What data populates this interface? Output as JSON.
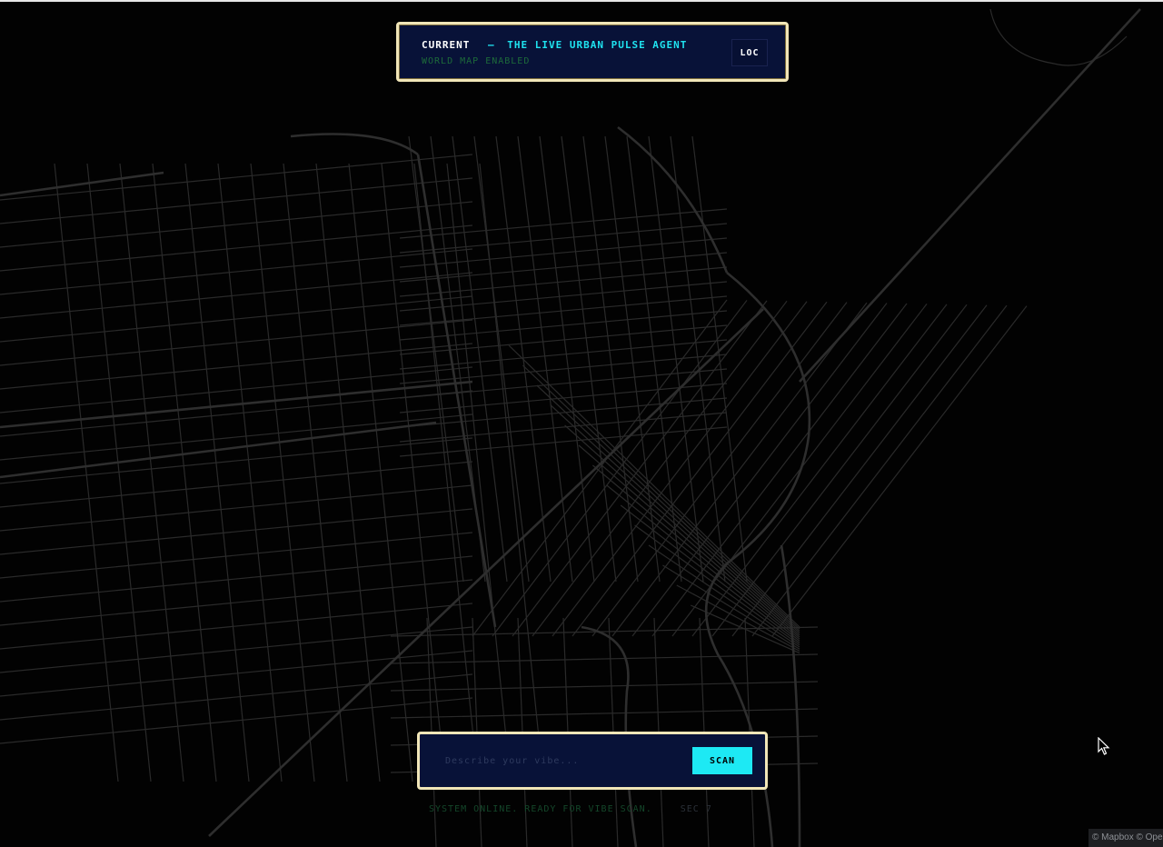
{
  "header": {
    "current_label": "CURRENT",
    "separator": "–",
    "app_name": "THE LIVE URBAN PULSE AGENT",
    "subtitle": "WORLD MAP ENABLED",
    "loc_button_label": "LOC"
  },
  "search": {
    "placeholder": "Describe your vibe...",
    "value": "",
    "scan_button_label": "SCAN"
  },
  "status": {
    "message": "SYSTEM ONLINE. READY FOR VIBE SCAN.",
    "sector": "SEC 7"
  },
  "map": {
    "attribution": "© Mapbox © OpenStreetMap",
    "road_color": "#2a2a2a",
    "background_color": "#020202"
  },
  "colors": {
    "accent": "#1de9f4",
    "panel_bg": "#081238",
    "panel_border": "#f1e6b8",
    "status_green": "#14472a"
  },
  "icons": {
    "cursor": "mouse-pointer-icon"
  }
}
